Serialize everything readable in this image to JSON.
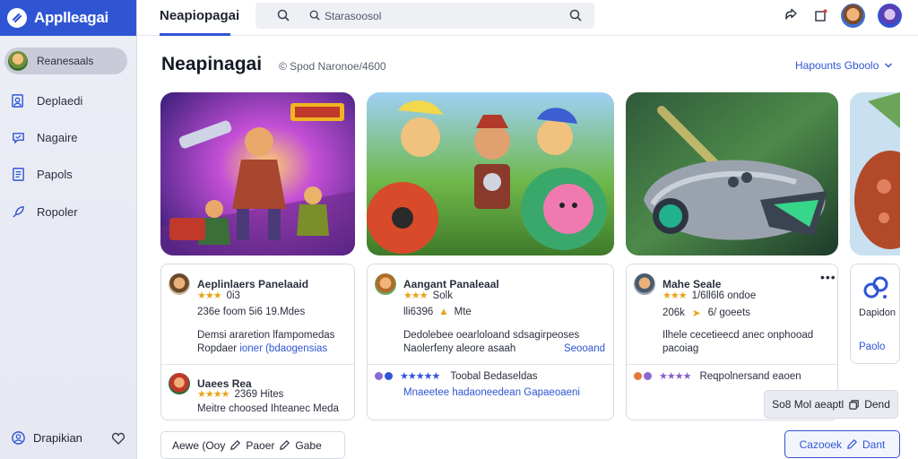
{
  "app": {
    "name": "Applleagai"
  },
  "sidebar": {
    "profile_label": "Reanesaals",
    "items": [
      {
        "label": "Deplaedi",
        "icon": "profile-icon"
      },
      {
        "label": "Nagaire",
        "icon": "chat-icon"
      },
      {
        "label": "Papols",
        "icon": "document-icon"
      },
      {
        "label": "Ropoler",
        "icon": "rocket-icon"
      }
    ],
    "footer_label": "Drapikian"
  },
  "topbar": {
    "title": "Neapiopagai",
    "search_placeholder": "Starasoosol"
  },
  "header": {
    "title": "Neapinagai",
    "subtitle": "© Spod Naronoe/4600",
    "link": "Hapounts Gboolo"
  },
  "cards": [
    {
      "title": "Aeplinlaers Panelaaid",
      "rating": "0i3",
      "stats": "236e foom 5i6 19.Mdes",
      "desc_line1": "Demsi araretion lfampomedas",
      "desc_line2_a": "Ropdaer",
      "desc_line2_b": "ioner (bdaogensias",
      "sub_title": "Uaees Rea",
      "sub_rating": "2369 Hites",
      "sub_desc": "Meitre choosed Ihteanec Meda"
    },
    {
      "title": "Aangant Panaleaal",
      "rating": "Solk",
      "stats_a": "lli6396",
      "stats_b": "Mte",
      "desc_line1": "Dedolebee oearloloand sdsagirpeoses",
      "desc_line2": "Naolerfeny aleore asaah",
      "desc_link": "Seooand",
      "footer_text": "Toobal Bedaseldas",
      "footer_link": "Mnaeetee hadaoneedean Gapaeoaeni"
    },
    {
      "title": "Mahe Seale",
      "rating": "1/6ll6l6 ondoe",
      "stats_a": "206k",
      "stats_b": "6/ goeets",
      "desc_line1": "Ilhele cecetieecd anec onphooad",
      "desc_line2": "pacoiag",
      "footer_text": "Reqpolnersand eaoen",
      "action_label": "So8 Mol aeaptl",
      "action_btn": "Dend"
    },
    {
      "label": "Dapidon",
      "link": "Paolo"
    }
  ],
  "bottom": {
    "chip_a": "Aewe (Ooy",
    "chip_b": "Paoer",
    "chip_c": "Gabe",
    "button_a": "Cazooek",
    "button_b": "Dant"
  }
}
